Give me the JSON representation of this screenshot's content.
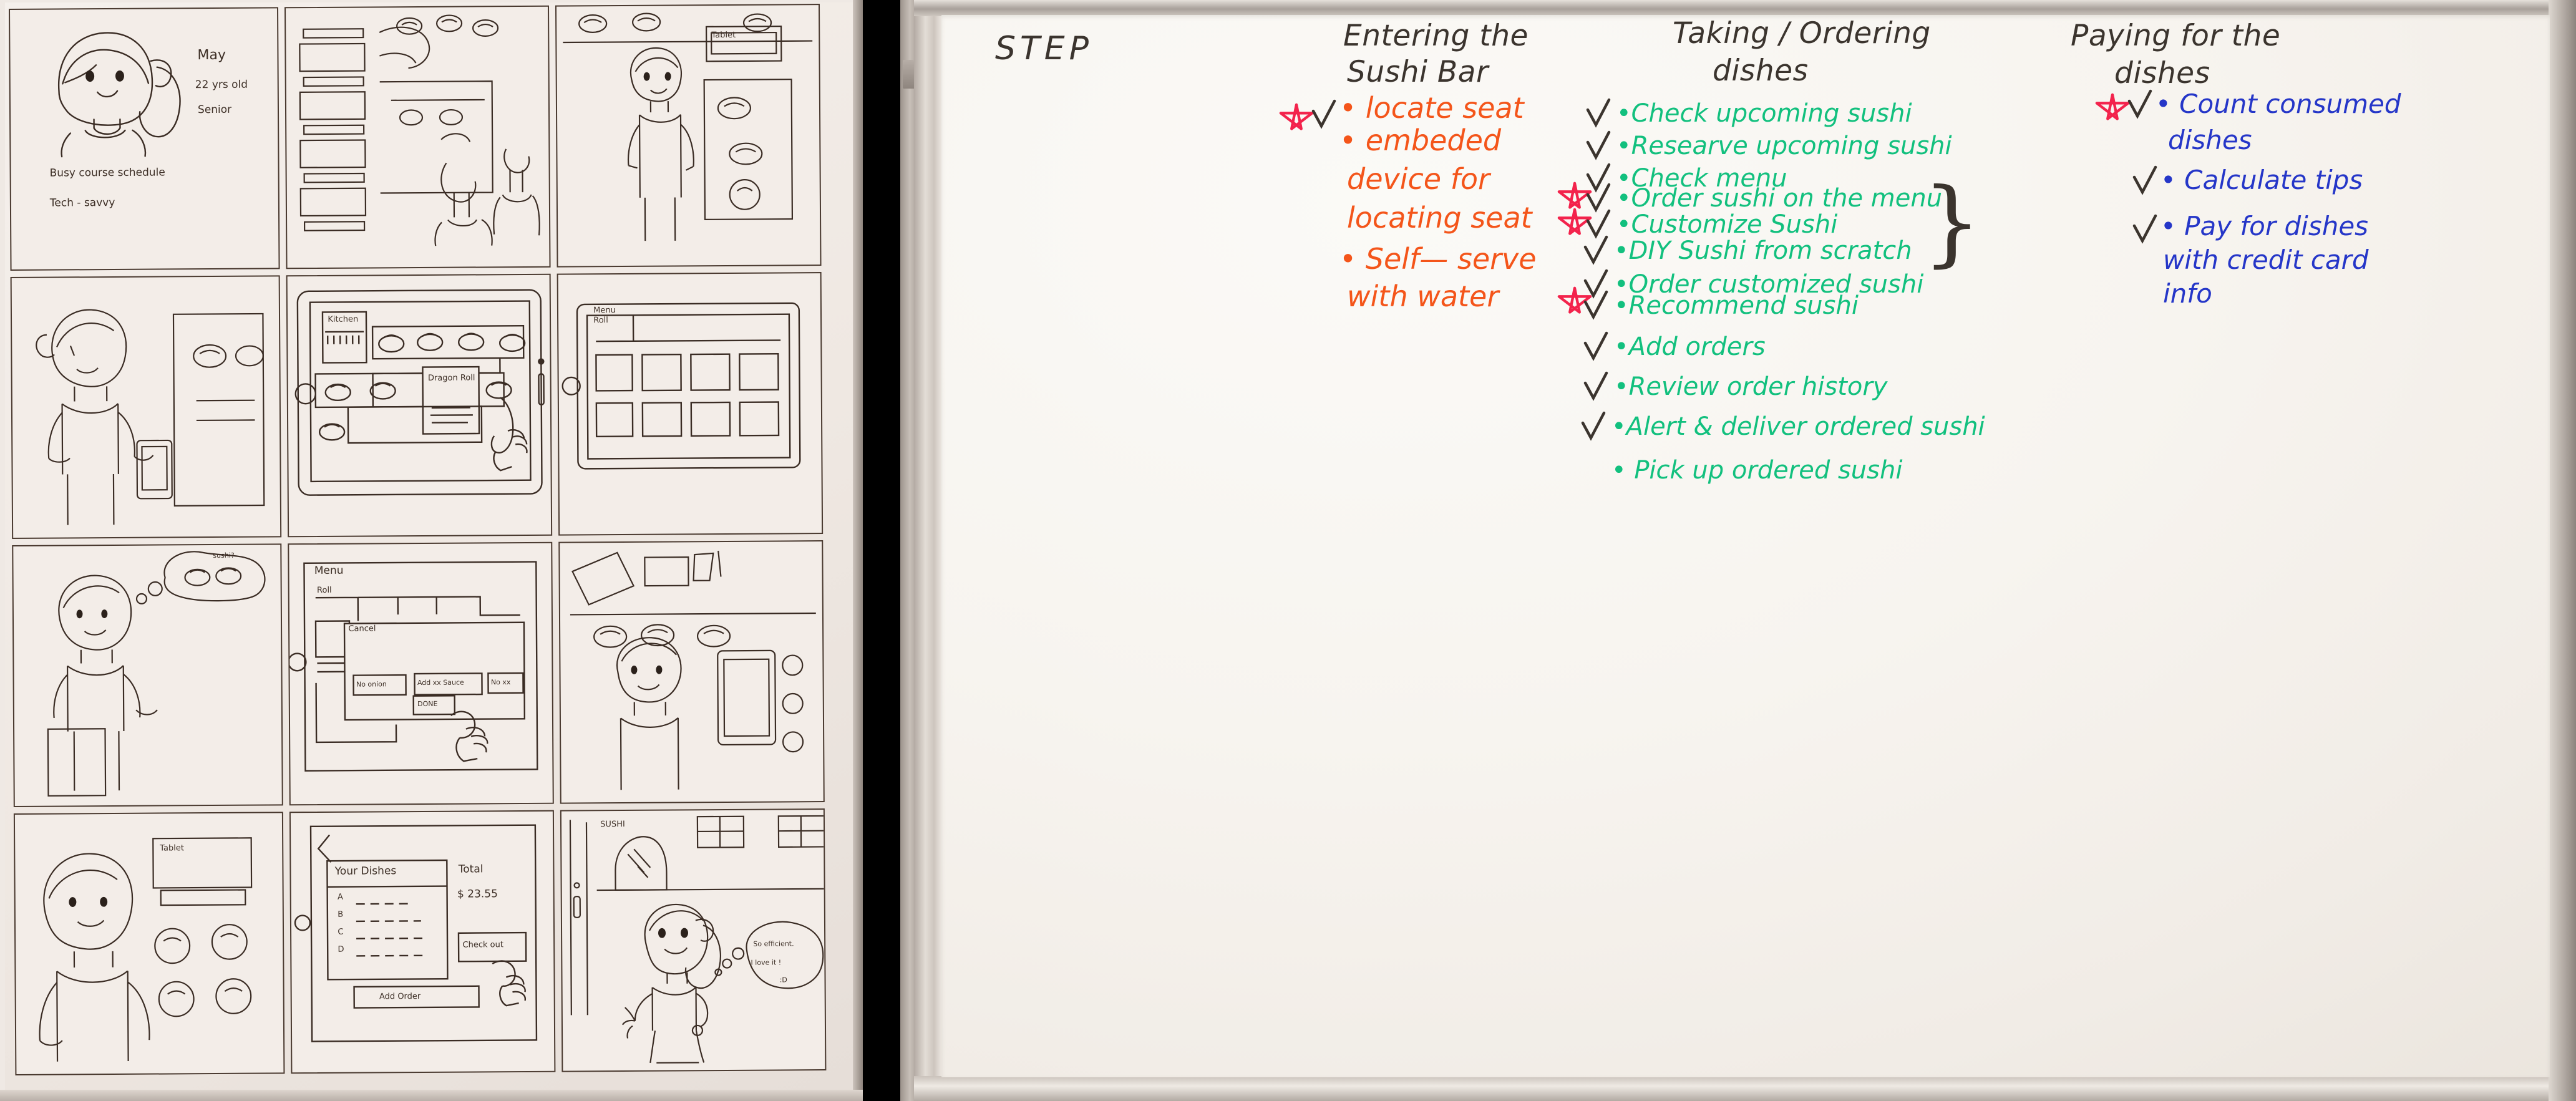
{
  "left_photo": {
    "name": "storyboard-sketch-sheet",
    "panels": [
      {
        "id": "p1-persona",
        "texts": [
          "May",
          "22 yrs old",
          "Senior",
          "Busy course schedule",
          "Tech - savvy"
        ]
      },
      {
        "id": "p2-sushi-belt-ui",
        "texts": []
      },
      {
        "id": "p3-entering-restaurant",
        "texts": [
          "Tablet"
        ]
      },
      {
        "id": "p4-girl-with-phone",
        "texts": []
      },
      {
        "id": "p5-seat-map-tablet",
        "texts": [
          "Kitchen",
          "Dragon Roll"
        ]
      },
      {
        "id": "p6-menu-tablet",
        "texts": [
          "Menu",
          "Roll"
        ]
      },
      {
        "id": "p7-girl-thinking",
        "texts": [
          "sushi?"
        ]
      },
      {
        "id": "p8-customize-dialog",
        "texts": [
          "Menu",
          "Roll",
          "Cancel",
          "No onion",
          "Add xx Sauce",
          "No xx",
          "DONE"
        ]
      },
      {
        "id": "p9-conveyor-delivery",
        "texts": []
      },
      {
        "id": "p10-girl-at-tablet",
        "texts": [
          "Tablet"
        ]
      },
      {
        "id": "p11-checkout-screen",
        "texts": [
          "Your Dishes",
          "A",
          "B",
          "C",
          "D",
          "Total",
          "$ 23.55",
          "Check out",
          "Add Order"
        ]
      },
      {
        "id": "p12-leaving-happy",
        "texts": [
          "SUSHI",
          "So efficient.",
          "I love it !",
          ":D"
        ]
      }
    ]
  },
  "whiteboard": {
    "name": "whiteboard-photo",
    "step_label": "STEP",
    "colors": {
      "black_marker": "#3b342e",
      "orange_marker": "#f4551a",
      "green_marker": "#12c07e",
      "blue_marker": "#2536c8",
      "red_marker": "#f3234c",
      "board_surface": "#f7f4ef"
    },
    "columns": [
      {
        "id": "col-entering",
        "heading_line1": "Entering the",
        "heading_line2": "Sushi Bar",
        "marker": "orange",
        "items": [
          {
            "text_lines": [
              "locate seat"
            ],
            "checked": false,
            "starred": false
          },
          {
            "text_lines": [
              "embeded",
              "device for",
              "locating seat"
            ],
            "checked": true,
            "starred": true
          },
          {
            "text_lines": [
              "Self— serve",
              "with water"
            ],
            "checked": false,
            "starred": false
          }
        ]
      },
      {
        "id": "col-taking-ordering",
        "heading_line1": "Taking / Ordering",
        "heading_line2": "dishes",
        "marker": "green",
        "brace_group": [
          "Customize Sushi",
          "DIY Sushi from scratch"
        ],
        "items": [
          {
            "text_lines": [
              "Check upcoming sushi"
            ],
            "checked": true,
            "starred": false
          },
          {
            "text_lines": [
              "Researve upcoming sushi"
            ],
            "checked": true,
            "starred": false
          },
          {
            "text_lines": [
              "Check menu"
            ],
            "checked": true,
            "starred": false
          },
          {
            "text_lines": [
              "Order sushi on the menu"
            ],
            "checked": true,
            "starred": true
          },
          {
            "text_lines": [
              "Customize Sushi"
            ],
            "checked": true,
            "starred": true
          },
          {
            "text_lines": [
              "DIY Sushi from scratch"
            ],
            "checked": true,
            "starred": false
          },
          {
            "text_lines": [
              "Order customized sushi"
            ],
            "checked": true,
            "starred": false
          },
          {
            "text_lines": [
              "Recommend sushi"
            ],
            "checked": true,
            "starred": true
          },
          {
            "text_lines": [
              "Add orders"
            ],
            "checked": true,
            "starred": false
          },
          {
            "text_lines": [
              "Review order history"
            ],
            "checked": true,
            "starred": false
          },
          {
            "text_lines": [
              "Alert & deliver ordered sushi"
            ],
            "checked": true,
            "starred": false
          },
          {
            "text_lines": [
              "Pick up ordered sushi"
            ],
            "checked": false,
            "starred": false
          }
        ]
      },
      {
        "id": "col-paying",
        "heading_line1": "Paying for the",
        "heading_line2": "dishes",
        "marker": "blue",
        "items": [
          {
            "text_lines": [
              "Count consumed",
              "dishes"
            ],
            "checked": true,
            "starred": true
          },
          {
            "text_lines": [
              "Calculate tips"
            ],
            "checked": true,
            "starred": false
          },
          {
            "text_lines": [
              "Pay for dishes",
              "with credit card",
              "info"
            ],
            "checked": true,
            "starred": false
          }
        ]
      }
    ]
  }
}
